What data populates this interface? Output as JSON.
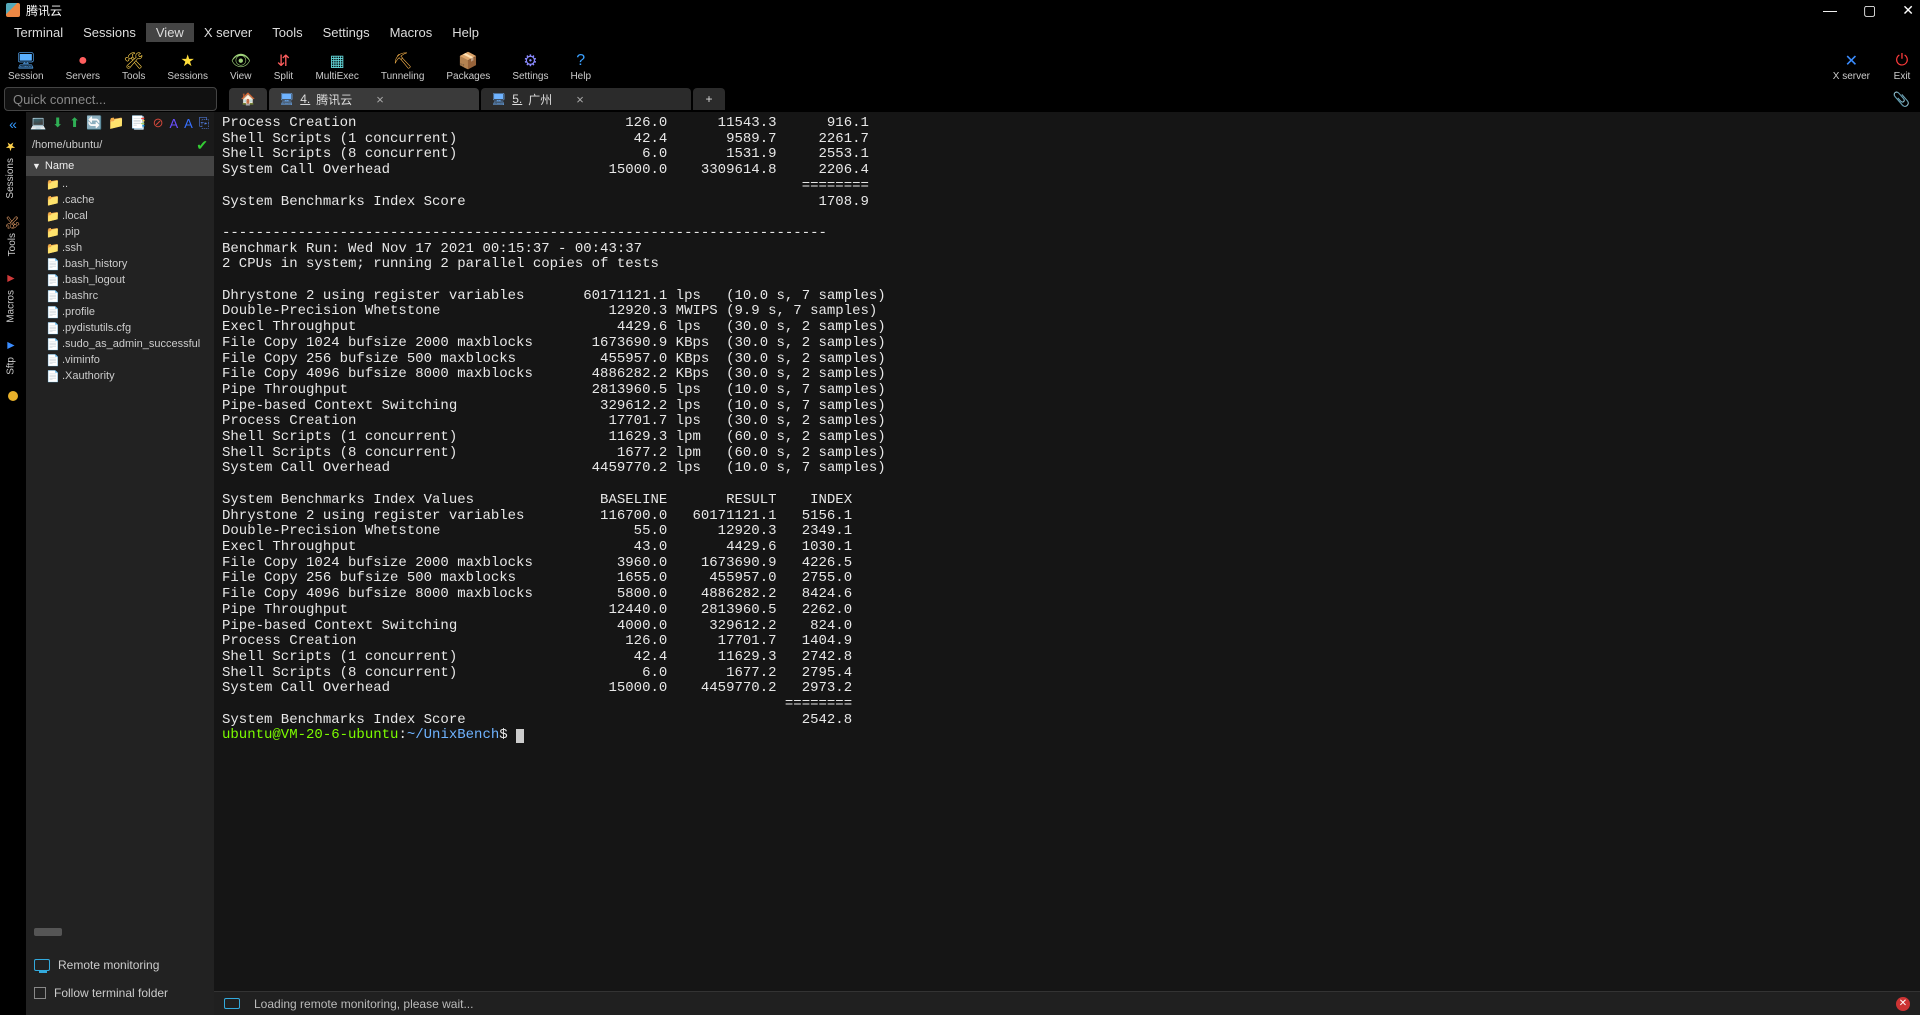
{
  "window": {
    "title": "腾讯云"
  },
  "menu": [
    "Terminal",
    "Sessions",
    "View",
    "X server",
    "Tools",
    "Settings",
    "Macros",
    "Help"
  ],
  "menu_active_index": 2,
  "toolbar": [
    {
      "icon": "🖥",
      "label": "Session",
      "color": "#5ab0ff"
    },
    {
      "icon": "●",
      "label": "Servers",
      "color": "#ff5e5e"
    },
    {
      "icon": "🛠",
      "label": "Tools",
      "color": "#ffd24d"
    },
    {
      "icon": "★",
      "label": "Sessions",
      "color": "#ffde3b"
    },
    {
      "icon": "👁",
      "label": "View",
      "color": "#9fd27a"
    },
    {
      "icon": "⇵",
      "label": "Split",
      "color": "#ff5e5e"
    },
    {
      "icon": "▦",
      "label": "MultiExec",
      "color": "#64d8db"
    },
    {
      "icon": "⛏",
      "label": "Tunneling",
      "color": "#ffb84d"
    },
    {
      "icon": "📦",
      "label": "Packages",
      "color": "#d46aff"
    },
    {
      "icon": "⚙",
      "label": "Settings",
      "color": "#8a8aff"
    },
    {
      "icon": "?",
      "label": "Help",
      "color": "#3aa0ff"
    }
  ],
  "toolbar_right": [
    {
      "icon": "✕",
      "label": "X server",
      "color": "#3a8cff"
    },
    {
      "icon": "⏻",
      "label": "Exit",
      "color": "#ff3b3b"
    }
  ],
  "quick_connect_placeholder": "Quick connect...",
  "tabs": [
    {
      "type": "home",
      "icon": "🏠"
    },
    {
      "type": "session",
      "num": "4.",
      "label": "腾讯云",
      "active": true,
      "icon": "🖥"
    },
    {
      "type": "session",
      "num": "5.",
      "label": "广州",
      "active": false,
      "icon": "🖥"
    },
    {
      "type": "plus",
      "label": "+"
    }
  ],
  "vrail": [
    {
      "label": "Sessions",
      "icon": "★",
      "color": "#ffd24d"
    },
    {
      "label": "Tools",
      "icon": "🛠",
      "color": "#ffb074"
    },
    {
      "label": "Macros",
      "icon": "◄",
      "color": "#d03a3a"
    },
    {
      "label": "Sftp",
      "icon": "◄",
      "color": "#3a8cff"
    }
  ],
  "sidebar": {
    "path": "/home/ubuntu/",
    "col_header": "Name",
    "tool_icons": [
      {
        "glyph": "💻",
        "color": "#e2c14a"
      },
      {
        "glyph": "⬇",
        "color": "#2faf55"
      },
      {
        "glyph": "⬆",
        "color": "#2faf55"
      },
      {
        "glyph": "🔄",
        "color": "#2faf55"
      },
      {
        "glyph": "📁",
        "color": "#e2a63a"
      },
      {
        "glyph": "📑",
        "color": "#d0463a"
      },
      {
        "glyph": "⊘",
        "color": "#d0463a"
      },
      {
        "glyph": "A",
        "color": "#6a4fff"
      },
      {
        "glyph": "A",
        "color": "#3770ff"
      },
      {
        "glyph": "⎘",
        "color": "#5a8cff"
      }
    ],
    "files": [
      {
        "name": "..",
        "icon": "📁",
        "color": "#6fd96f"
      },
      {
        "name": ".cache",
        "icon": "📁",
        "color": "#e2a63a"
      },
      {
        "name": ".local",
        "icon": "📁",
        "color": "#e2a63a"
      },
      {
        "name": ".pip",
        "icon": "📁",
        "color": "#e2a63a"
      },
      {
        "name": ".ssh",
        "icon": "📁",
        "color": "#e2a63a"
      },
      {
        "name": ".bash_history",
        "icon": "📄",
        "color": "#ccc"
      },
      {
        "name": ".bash_logout",
        "icon": "📄",
        "color": "#ccc"
      },
      {
        "name": ".bashrc",
        "icon": "📄",
        "color": "#ccc"
      },
      {
        "name": ".profile",
        "icon": "📄",
        "color": "#ccc"
      },
      {
        "name": ".pydistutils.cfg",
        "icon": "📄",
        "color": "#ccc"
      },
      {
        "name": ".sudo_as_admin_successful",
        "icon": "📄",
        "color": "#ccc"
      },
      {
        "name": ".viminfo",
        "icon": "📄",
        "color": "#ccc"
      },
      {
        "name": ".Xauthority",
        "icon": "📄",
        "color": "#ccc"
      }
    ],
    "remote_monitoring": "Remote monitoring",
    "follow_terminal": "Follow terminal folder"
  },
  "status": {
    "loading": "Loading remote monitoring, please wait..."
  },
  "terminal": {
    "prompt_user": "ubuntu@VM-20-6-ubuntu",
    "prompt_sep": ":",
    "prompt_path": "~/UnixBench",
    "prompt_dollar": "$",
    "lines": [
      "Process Creation                                126.0      11543.3      916.1",
      "Shell Scripts (1 concurrent)                     42.4       9589.7     2261.7",
      "Shell Scripts (8 concurrent)                      6.0       1531.9     2553.1",
      "System Call Overhead                          15000.0    3309614.8     2206.4",
      "                                                                     ========",
      "System Benchmarks Index Score                                          1708.9",
      "",
      "------------------------------------------------------------------------",
      "Benchmark Run: Wed Nov 17 2021 00:15:37 - 00:43:37",
      "2 CPUs in system; running 2 parallel copies of tests",
      "",
      "Dhrystone 2 using register variables       60171121.1 lps   (10.0 s, 7 samples)",
      "Double-Precision Whetstone                    12920.3 MWIPS (9.9 s, 7 samples)",
      "Execl Throughput                               4429.6 lps   (30.0 s, 2 samples)",
      "File Copy 1024 bufsize 2000 maxblocks       1673690.9 KBps  (30.0 s, 2 samples)",
      "File Copy 256 bufsize 500 maxblocks          455957.0 KBps  (30.0 s, 2 samples)",
      "File Copy 4096 bufsize 8000 maxblocks       4886282.2 KBps  (30.0 s, 2 samples)",
      "Pipe Throughput                             2813960.5 lps   (10.0 s, 7 samples)",
      "Pipe-based Context Switching                 329612.2 lps   (10.0 s, 7 samples)",
      "Process Creation                              17701.7 lps   (30.0 s, 2 samples)",
      "Shell Scripts (1 concurrent)                  11629.3 lpm   (60.0 s, 2 samples)",
      "Shell Scripts (8 concurrent)                   1677.2 lpm   (60.0 s, 2 samples)",
      "System Call Overhead                        4459770.2 lps   (10.0 s, 7 samples)",
      "",
      "System Benchmarks Index Values               BASELINE       RESULT    INDEX",
      "Dhrystone 2 using register variables         116700.0   60171121.1   5156.1",
      "Double-Precision Whetstone                       55.0      12920.3   2349.1",
      "Execl Throughput                                 43.0       4429.6   1030.1",
      "File Copy 1024 bufsize 2000 maxblocks          3960.0    1673690.9   4226.5",
      "File Copy 256 bufsize 500 maxblocks            1655.0     455957.0   2755.0",
      "File Copy 4096 bufsize 8000 maxblocks          5800.0    4886282.2   8424.6",
      "Pipe Throughput                               12440.0    2813960.5   2262.0",
      "Pipe-based Context Switching                   4000.0     329612.2    824.0",
      "Process Creation                                126.0      17701.7   1404.9",
      "Shell Scripts (1 concurrent)                     42.4      11629.3   2742.8",
      "Shell Scripts (8 concurrent)                      6.0       1677.2   2795.4",
      "System Call Overhead                          15000.0    4459770.2   2973.2",
      "                                                                   ========",
      "System Benchmarks Index Score                                        2542.8"
    ]
  }
}
